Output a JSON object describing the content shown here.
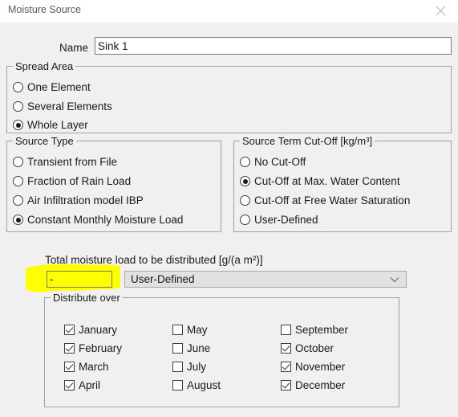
{
  "window": {
    "title": "Moisture Source",
    "close_icon": "close-icon"
  },
  "name_field": {
    "label": "Name",
    "value": "Sink 1",
    "placeholder": ""
  },
  "spread_area": {
    "title": "Spread Area",
    "options": [
      {
        "label": "One Element",
        "selected": false
      },
      {
        "label": "Several Elements",
        "selected": false
      },
      {
        "label": "Whole Layer",
        "selected": true
      }
    ]
  },
  "source_type": {
    "title": "Source Type",
    "options": [
      {
        "label": "Transient from File",
        "selected": false
      },
      {
        "label": "Fraction of Rain Load",
        "selected": false
      },
      {
        "label": "Air Infiltration model IBP",
        "selected": false
      },
      {
        "label": "Constant Monthly Moisture Load",
        "selected": true
      }
    ]
  },
  "source_term_cutoff": {
    "title": "Source Term Cut-Off [kg/m³]",
    "options": [
      {
        "label": "No Cut-Off",
        "selected": false
      },
      {
        "label": "Cut-Off at Max. Water Content",
        "selected": true
      },
      {
        "label": "Cut-Off at Free Water Saturation",
        "selected": false
      },
      {
        "label": "User-Defined",
        "selected": false
      }
    ]
  },
  "total_load": {
    "label": "Total moisture load to be distributed [g/(a m²)]",
    "value": "-",
    "placeholder": "",
    "highlight_color": "#ffff00",
    "dropdown": {
      "selected": "User-Defined",
      "arrow_icon": "chevron-down-icon",
      "options": [
        "User-Defined"
      ]
    }
  },
  "distribute_over": {
    "title": "Distribute over",
    "months": [
      {
        "label": "January",
        "checked": true
      },
      {
        "label": "February",
        "checked": true
      },
      {
        "label": "March",
        "checked": true
      },
      {
        "label": "April",
        "checked": true
      },
      {
        "label": "May",
        "checked": false
      },
      {
        "label": "June",
        "checked": false
      },
      {
        "label": "July",
        "checked": false
      },
      {
        "label": "August",
        "checked": false
      },
      {
        "label": "September",
        "checked": false
      },
      {
        "label": "October",
        "checked": true
      },
      {
        "label": "November",
        "checked": true
      },
      {
        "label": "December",
        "checked": true
      }
    ]
  }
}
